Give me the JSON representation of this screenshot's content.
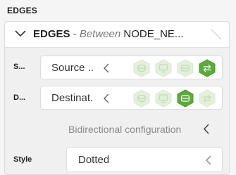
{
  "section": {
    "title": "EDGES"
  },
  "card": {
    "title_strong": "EDGES",
    "title_dash": " - ",
    "title_italic": "Between",
    "title_target": " NODE_NE..."
  },
  "source": {
    "label": "S...",
    "value": "Source ..",
    "icons": [
      {
        "name": "stack-icon",
        "active": false
      },
      {
        "name": "monitor-icon",
        "active": false
      },
      {
        "name": "database-icon",
        "active": false
      },
      {
        "name": "swap-arrows-icon",
        "active": true
      }
    ]
  },
  "destination": {
    "label": "D...",
    "value": "Destinat.",
    "icons": [
      {
        "name": "stack-icon",
        "active": false
      },
      {
        "name": "monitor-icon",
        "active": false
      },
      {
        "name": "database-icon",
        "active": true
      },
      {
        "name": "swap-arrows-icon",
        "active": false
      }
    ]
  },
  "bidirectional": {
    "label": "Bidirectional configuration"
  },
  "style": {
    "label": "Style",
    "value": "Dotted"
  },
  "colors": {
    "active_fill": "#5aab3b",
    "inactive_fill": "#e3f0dc",
    "inactive_glyph": "#c2ddb4"
  }
}
